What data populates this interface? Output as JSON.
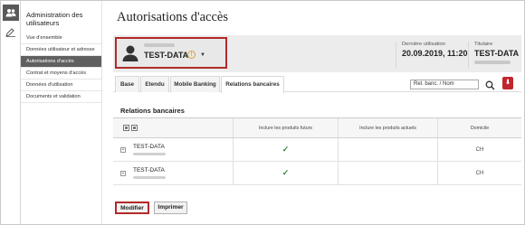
{
  "iconbar": {
    "icons": [
      "users-icon",
      "edit-icon"
    ]
  },
  "sidebar": {
    "title": "Administration des utilisateurs",
    "items": [
      {
        "label": "Vue d'ensemble",
        "active": false
      },
      {
        "label": "Données utilisateur et adresse",
        "active": false
      },
      {
        "label": "Autorisations d'accès",
        "active": true
      },
      {
        "label": "Contrat et moyens d'accès",
        "active": false
      },
      {
        "label": "Données d'utilisation",
        "active": false
      },
      {
        "label": "Documents et validation",
        "active": false
      }
    ]
  },
  "page": {
    "title": "Autorisations d'accès"
  },
  "user": {
    "name": "TEST-DATA",
    "warning_icon": "warning-icon"
  },
  "last_use": {
    "label": "Dernière utilisation",
    "value": "20.09.2019, 11:20"
  },
  "holder": {
    "label": "Titulaire",
    "value": "TEST-DATA"
  },
  "tabs": [
    {
      "label": "Base",
      "active": false
    },
    {
      "label": "Etendu",
      "active": false
    },
    {
      "label": "Mobile Banking",
      "active": false
    },
    {
      "label": "Relations bancaires",
      "active": true
    }
  ],
  "search": {
    "value": "Rel. banc. / Nom"
  },
  "section": {
    "title": "Relations bancaires"
  },
  "table": {
    "headers": [
      "",
      "Inclure les produits futurs",
      "Inclure les produits actuels",
      "Domicile"
    ],
    "rows": [
      {
        "name": "TEST-DATA",
        "future": true,
        "current": false,
        "domicile": "CH"
      },
      {
        "name": "TEST-DATA",
        "future": true,
        "current": false,
        "domicile": "CH"
      }
    ]
  },
  "buttons": {
    "modify": "Modifier",
    "print": "Imprimer"
  },
  "colors": {
    "accent_red": "#b22a2a",
    "check_green": "#2f8a3d",
    "sidebar_active": "#606060"
  }
}
